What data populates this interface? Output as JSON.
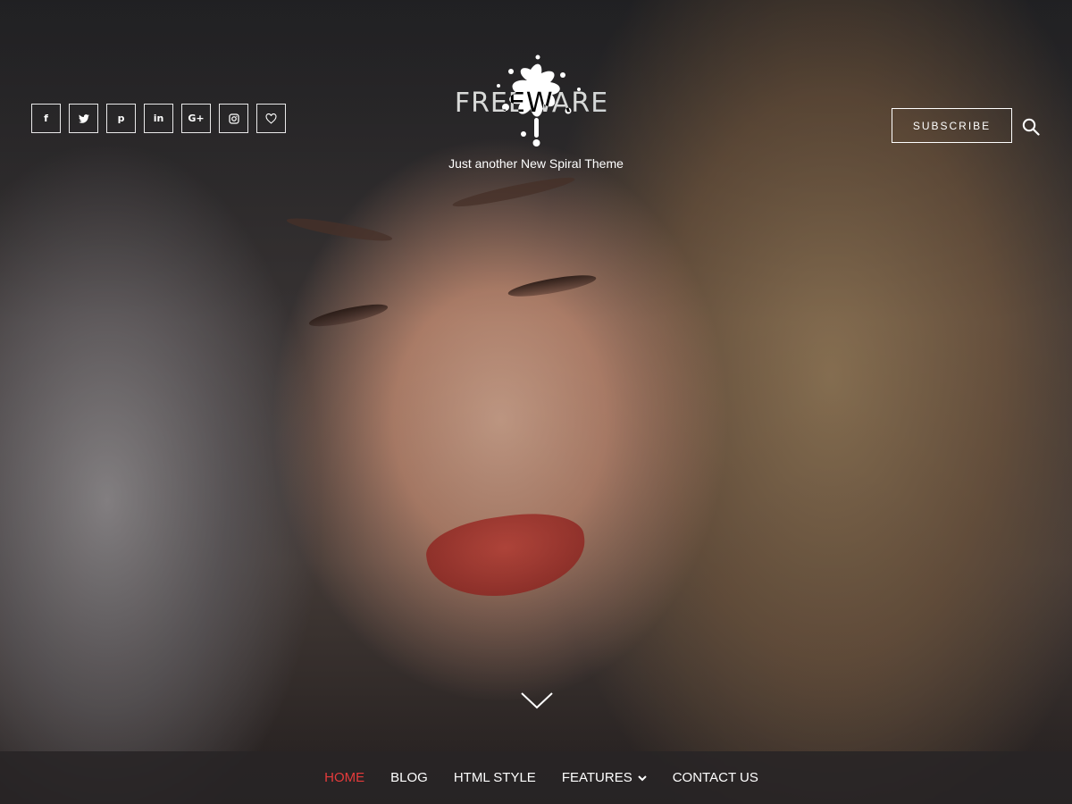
{
  "header": {
    "social_icons": [
      {
        "name": "facebook-icon",
        "glyph": "f"
      },
      {
        "name": "twitter-icon",
        "glyph": "t"
      },
      {
        "name": "pinterest-icon",
        "glyph": "p"
      },
      {
        "name": "linkedin-icon",
        "glyph": "in"
      },
      {
        "name": "google-plus-icon",
        "glyph": "G+"
      },
      {
        "name": "instagram-icon",
        "glyph": "◎"
      },
      {
        "name": "heart-icon",
        "glyph": "♡"
      }
    ],
    "logo_text": "FREEWARE",
    "tagline": "Just another New Spiral Theme",
    "subscribe_label": "SUBSCRIBE"
  },
  "nav": {
    "items": [
      {
        "label": "HOME",
        "active": true
      },
      {
        "label": "BLOG",
        "active": false
      },
      {
        "label": "HTML STYLE",
        "active": false
      },
      {
        "label": "FEATURES",
        "active": false,
        "has_dropdown": true
      },
      {
        "label": "CONTACT US",
        "active": false
      }
    ]
  },
  "colors": {
    "accent": "#e53b3b",
    "nav_bg": "#282426",
    "text": "#ffffff"
  }
}
